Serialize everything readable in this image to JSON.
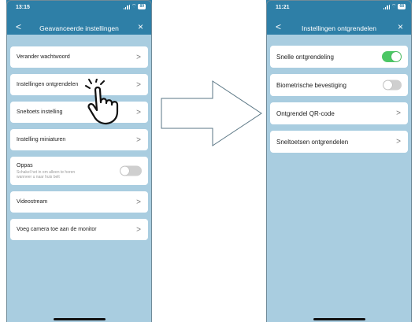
{
  "left_screen": {
    "status": {
      "time": "13:15",
      "battery": "89"
    },
    "header": {
      "title": "Geavanceerde instellingen",
      "back_glyph": "<",
      "close_glyph": "×"
    },
    "items": [
      {
        "label": "Verander wachtwoord",
        "type": "nav"
      },
      {
        "label": "Instellingen ontgrendelen",
        "type": "nav"
      },
      {
        "label": "Sneltoets instelling",
        "type": "nav"
      },
      {
        "label": "Instelling miniaturen",
        "type": "nav"
      },
      {
        "label": "Oppas",
        "sublabel": "Schakel het in om alleen te horen wanneer u naar huis belt",
        "type": "toggle",
        "on": false
      },
      {
        "label": "Videostream",
        "type": "nav"
      },
      {
        "label": "Voeg camera toe aan de monitor",
        "type": "nav"
      }
    ],
    "chevron_glyph": ">"
  },
  "right_screen": {
    "status": {
      "time": "11:21",
      "battery": "68"
    },
    "header": {
      "title": "Instellingen ontgrendelen",
      "back_glyph": "<",
      "close_glyph": "×"
    },
    "items": [
      {
        "label": "Snelle ontgrendeling",
        "type": "toggle",
        "on": true
      },
      {
        "label": "Biometrische bevestiging",
        "type": "toggle",
        "on": false
      },
      {
        "label": "Ontgrendel QR-code",
        "type": "nav"
      },
      {
        "label": "Sneltoetsen ontgrendelen",
        "type": "nav"
      }
    ],
    "chevron_glyph": ">"
  },
  "colors": {
    "header_blue": "#2e7fa7",
    "screen_background": "#a9cde0",
    "toggle_on": "#4cc765",
    "toggle_off": "#cfcfcf"
  },
  "icons": [
    "signal-icon",
    "wifi-icon",
    "battery-icon",
    "back-icon",
    "close-icon",
    "chevron-right-icon",
    "tap-hand-icon",
    "right-arrow-icon"
  ]
}
